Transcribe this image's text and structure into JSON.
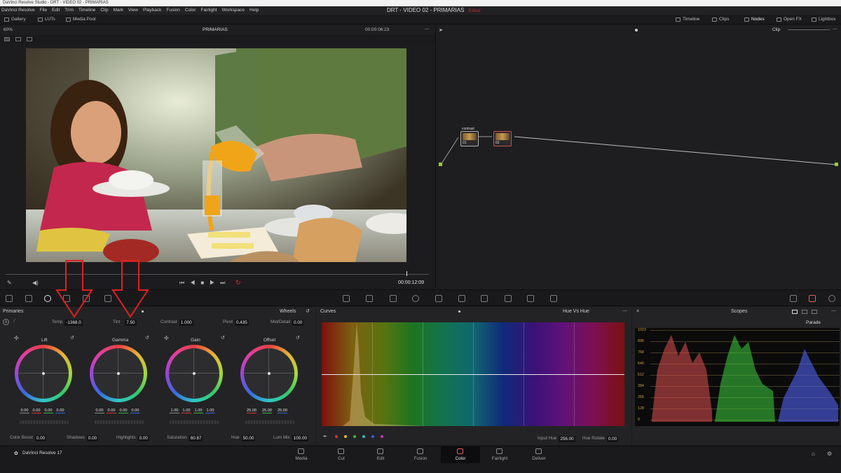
{
  "window": {
    "title": "DaVinci Resolve Studio - DRT - VIDEO 02 - PRIMARIAS"
  },
  "menu": [
    "DaVinci Resolve",
    "File",
    "Edit",
    "Trim",
    "Timeline",
    "Clip",
    "Mark",
    "View",
    "Playback",
    "Fusion",
    "Color",
    "Fairlight",
    "Workspace",
    "Help"
  ],
  "project": {
    "name": "DRT - VIDEO 02 - PRIMARIAS",
    "status": "Edited"
  },
  "toolbar": {
    "gallery": "Gallery",
    "luts": "LUTs",
    "media_pool": "Media Pool",
    "timeline": "Timeline",
    "clips": "Clips",
    "nodes": "Nodes",
    "open_fx": "Open FX",
    "lightbox": "Lightbox"
  },
  "viewer": {
    "zoom": "60%",
    "clip_name": "PRIMARIAS",
    "timecode_top": "00:00:06:23",
    "timecode": "00:00:12:09"
  },
  "nodes_panel": {
    "mode": "Clip",
    "node1_label": "contrast",
    "node1_num": "01",
    "node2_num": "02"
  },
  "primaries": {
    "title": "Primaries",
    "mode": "Wheels",
    "temp_label": "Temp",
    "temp": "-1368.0",
    "tint_label": "Tint",
    "tint": "7.50",
    "contrast_label": "Contrast",
    "contrast": "1.000",
    "pivot_label": "Pivot",
    "pivot": "0.435",
    "middetail_label": "Mid/Detail",
    "middetail": "0.00",
    "lift": {
      "label": "Lift",
      "values": [
        "0.00",
        "0.00",
        "0.00",
        "0.00"
      ]
    },
    "gamma": {
      "label": "Gamma",
      "values": [
        "0.00",
        "0.00",
        "0.00",
        "0.00"
      ]
    },
    "gain": {
      "label": "Gain",
      "values": [
        "1.00",
        "1.00",
        "1.00",
        "1.00"
      ]
    },
    "offset": {
      "label": "Offset",
      "values": [
        "25.00",
        "25.00",
        "25.00"
      ]
    },
    "colorboost_label": "Color Boost",
    "colorboost": "0.00",
    "shadows_label": "Shadows",
    "shadows": "0.00",
    "highlights_label": "Highlights",
    "highlights": "0.00",
    "saturation_label": "Saturation",
    "saturation": "60.87",
    "hue_label": "Hue",
    "hue": "50.00",
    "lummix_label": "Lum Mix",
    "lummix": "100.00"
  },
  "curves": {
    "title": "Curves",
    "mode": "Hue Vs Hue",
    "input_hue_label": "Input Hue",
    "input_hue": "256.00",
    "hue_rotate_label": "Hue Rotate",
    "hue_rotate": "0.00"
  },
  "scopes": {
    "title": "Scopes",
    "mode": "Parade",
    "scale": [
      "1023",
      "896",
      "768",
      "640",
      "512",
      "384",
      "256",
      "128",
      "0"
    ]
  },
  "app_label": "DaVinci Resolve 17",
  "pages": [
    "Media",
    "Cut",
    "Edit",
    "Fusion",
    "Color",
    "Fairlight",
    "Deliver"
  ],
  "colors": {
    "accent_red": "#e02020",
    "active_icon": "#e85a5a"
  }
}
